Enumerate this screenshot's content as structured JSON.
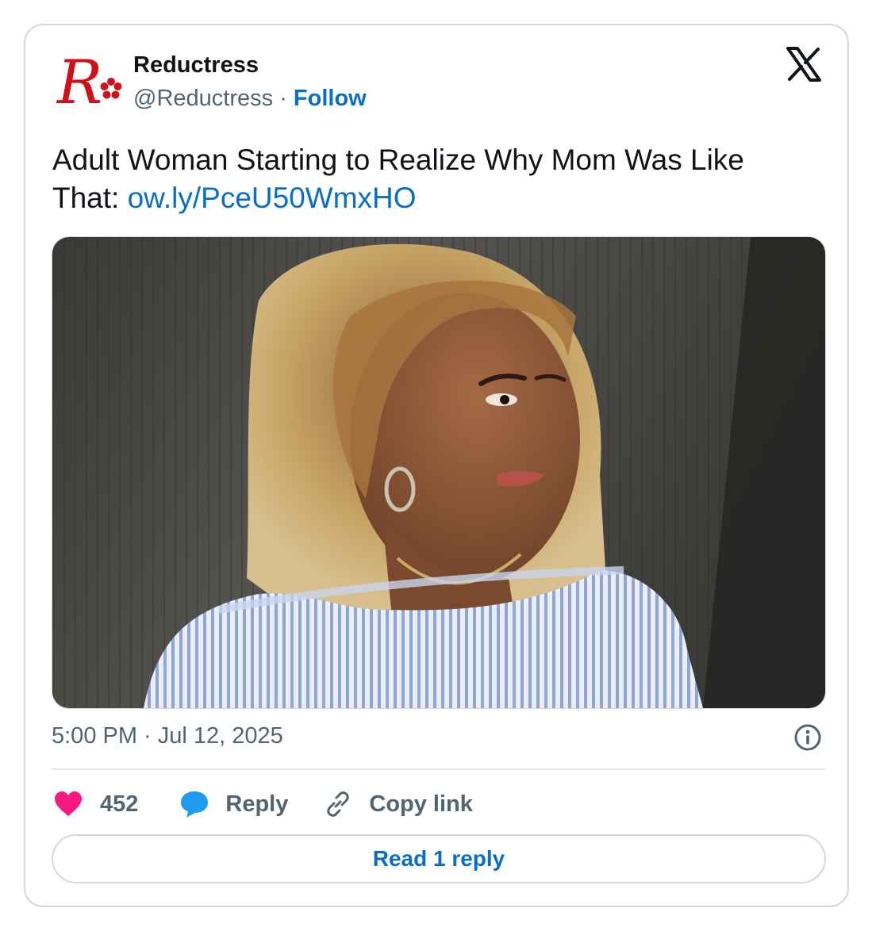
{
  "account": {
    "name": "Reductress",
    "handle": "@Reductress",
    "separator": " · ",
    "follow_label": "Follow",
    "logo_icon": "reductress-r-flower-logo",
    "logo_text": "R"
  },
  "platform_icon": "x-logo-icon",
  "tweet": {
    "text": "Adult Woman Starting to Realize Why Mom Was Like That: ",
    "link": "ow.ly/PceU50WmxHO"
  },
  "media": {
    "type": "photo",
    "icon": "photo-woman-curly-hair"
  },
  "meta": {
    "timestamp": "5:00 PM · Jul 12, 2025",
    "info_icon": "info-icon"
  },
  "actions": {
    "like_count": "452",
    "reply_label": "Reply",
    "copy_label": "Copy link",
    "like_icon": "heart-icon",
    "reply_icon": "speech-bubble-icon",
    "copy_icon": "link-icon"
  },
  "read_replies_label": "Read 1 reply",
  "colors": {
    "link": "#0a6ec4",
    "heart": "#f91880",
    "reply_bubble": "#1d9bf0",
    "brand_red": "#d0101b",
    "muted_text": "#536471",
    "border": "#cfd9de"
  }
}
